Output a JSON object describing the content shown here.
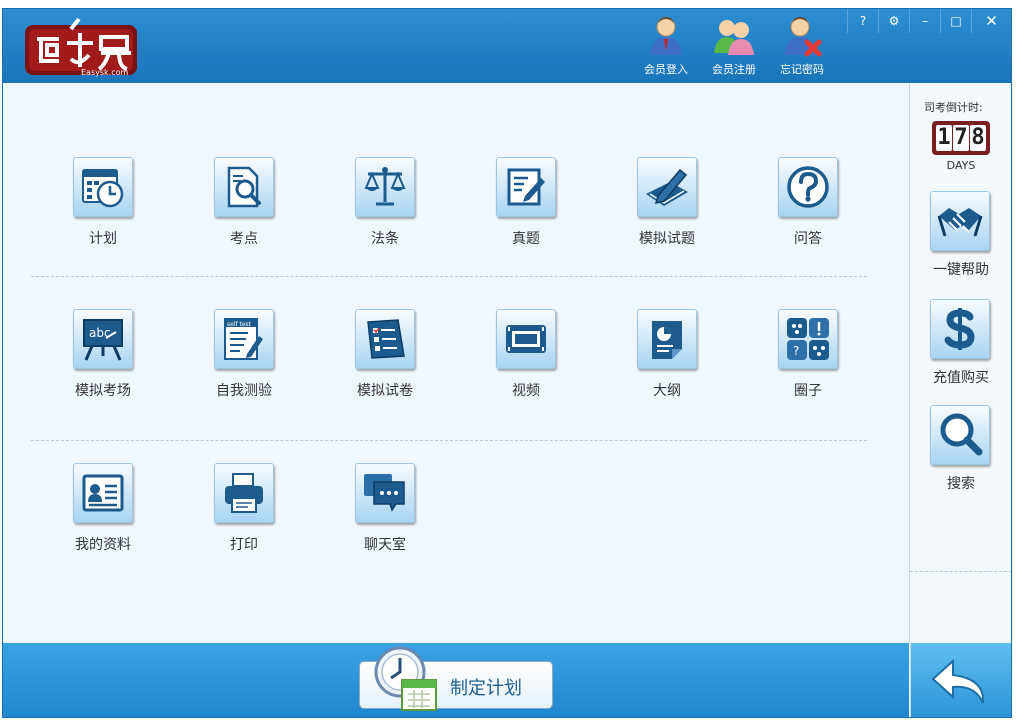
{
  "app": {
    "logo_text": "Easysk.com"
  },
  "header": {
    "actions": [
      {
        "label": "会员登入",
        "icon": "user-login-icon"
      },
      {
        "label": "会员注册",
        "icon": "user-register-icon"
      },
      {
        "label": "忘记密码",
        "icon": "user-forgot-password-icon"
      }
    ],
    "window_controls": {
      "help": "?",
      "settings": "⚙",
      "minimize": "–",
      "maximize": "□",
      "close": "✕"
    }
  },
  "modules": {
    "row1": [
      {
        "label": "计划",
        "icon": "calendar-clock-icon"
      },
      {
        "label": "考点",
        "icon": "document-search-icon"
      },
      {
        "label": "法条",
        "icon": "scales-icon"
      },
      {
        "label": "真题",
        "icon": "edit-paper-icon"
      },
      {
        "label": "模拟试题",
        "icon": "pen-writing-icon"
      },
      {
        "label": "问答",
        "icon": "question-icon"
      }
    ],
    "row2": [
      {
        "label": "模拟考场",
        "icon": "blackboard-icon"
      },
      {
        "label": "自我测验",
        "icon": "self-test-icon"
      },
      {
        "label": "模拟试卷",
        "icon": "checklist-icon"
      },
      {
        "label": "视频",
        "icon": "film-icon"
      },
      {
        "label": "大纲",
        "icon": "chart-document-icon"
      },
      {
        "label": "圈子",
        "icon": "circle-group-icon"
      }
    ],
    "row3": [
      {
        "label": "我的资料",
        "icon": "profile-card-icon"
      },
      {
        "label": "打印",
        "icon": "printer-icon"
      },
      {
        "label": "聊天室",
        "icon": "chat-bubbles-icon"
      }
    ],
    "self_test_badge": "self test",
    "blackboard_text": "abc"
  },
  "sidebar": {
    "countdown_title": "司考倒计时:",
    "countdown_digits": [
      "1",
      "7",
      "8"
    ],
    "countdown_unit": "DAYS",
    "buttons": [
      {
        "label": "一键帮助",
        "icon": "handshake-icon"
      },
      {
        "label": "充值购买",
        "icon": "dollar-icon"
      },
      {
        "label": "搜索",
        "icon": "magnifier-icon"
      }
    ]
  },
  "footer": {
    "plan_button_label": "制定计划",
    "back_icon": "back-arrow-icon"
  },
  "colors": {
    "header": "#1a74b9",
    "footer": "#1f86cc",
    "icon_blue": "#1d5a8e",
    "text": "#333333"
  }
}
